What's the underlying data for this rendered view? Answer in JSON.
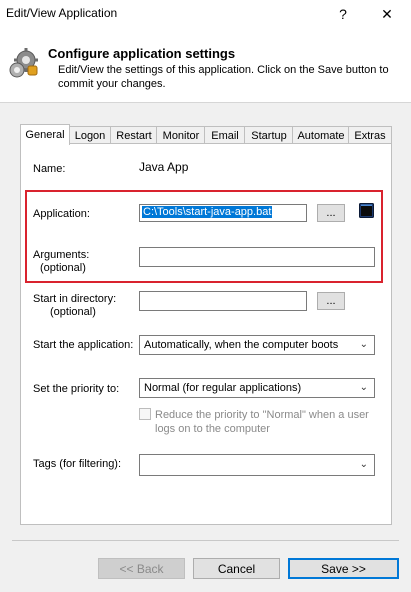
{
  "window": {
    "title": "Edit/View Application",
    "help_glyph": "?",
    "close_glyph": "✕"
  },
  "header": {
    "title": "Configure application settings",
    "description": "Edit/View the settings of this application. Click on the Save button to commit your changes.",
    "icon": "gears-icon"
  },
  "tabs": [
    {
      "label": "General",
      "active": true
    },
    {
      "label": "Logon",
      "active": false
    },
    {
      "label": "Restart",
      "active": false
    },
    {
      "label": "Monitor",
      "active": false
    },
    {
      "label": "Email",
      "active": false
    },
    {
      "label": "Startup",
      "active": false
    },
    {
      "label": "Automate",
      "active": false
    },
    {
      "label": "Extras",
      "active": false
    }
  ],
  "form": {
    "name_label": "Name:",
    "name_value": "Java App",
    "application_label": "Application:",
    "application_value": "C:\\Tools\\start-java-app.bat",
    "browse_label": "...",
    "arguments_label": "Arguments:",
    "arguments_sub": "(optional)",
    "arguments_value": "",
    "start_dir_label": "Start in directory:",
    "start_dir_sub": "(optional)",
    "start_dir_value": "",
    "start_app_label": "Start the application:",
    "start_app_value": "Automatically, when the computer boots",
    "priority_label": "Set the priority to:",
    "priority_value": "Normal (for regular applications)",
    "reduce_priority_label": "Reduce the priority to \"Normal\" when a user logs on to the computer",
    "tags_label": "Tags (for filtering):",
    "tags_value": ""
  },
  "buttons": {
    "back": "<< Back",
    "cancel": "Cancel",
    "save": "Save >>"
  },
  "colors": {
    "highlight_border": "#d9232e",
    "selection": "#0078d7",
    "primary_button_border": "#0078d7"
  }
}
